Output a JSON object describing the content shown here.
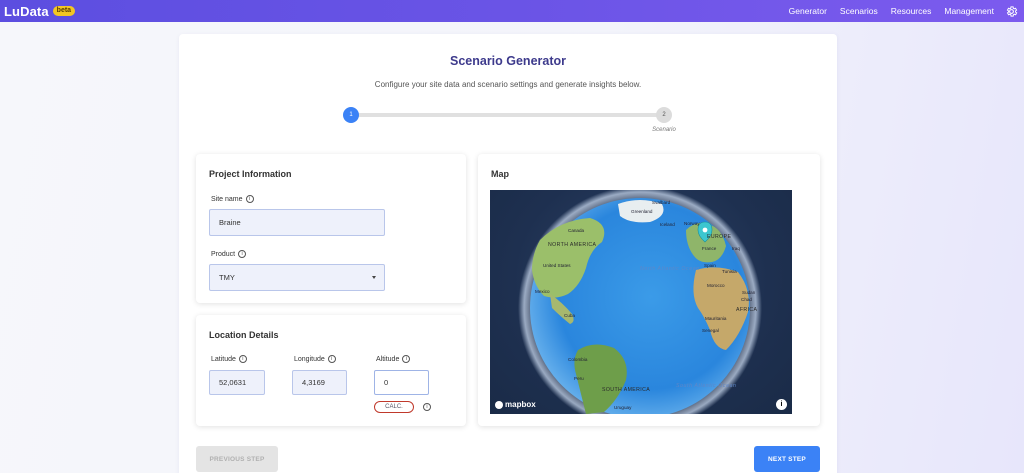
{
  "app": {
    "brand": "LuData",
    "badge": "beta"
  },
  "nav": {
    "items": [
      "Generator",
      "Scenarios",
      "Resources",
      "Management"
    ]
  },
  "page": {
    "title": "Scenario Generator",
    "subtitle": "Configure your site data and scenario settings and generate insights below."
  },
  "stepper": {
    "step1": "1",
    "step2": "2",
    "step2_label": "Scenario"
  },
  "project": {
    "title": "Project Information",
    "site_name_label": "Site name",
    "site_name_value": "Braine",
    "product_label": "Product",
    "product_value": "TMY"
  },
  "location": {
    "title": "Location Details",
    "latitude_label": "Latitude",
    "latitude_value": "52,0631",
    "longitude_label": "Longitude",
    "longitude_value": "4,3169",
    "altitude_label": "Altitude",
    "altitude_value": "0",
    "calc_label": "CALC."
  },
  "map": {
    "title": "Map",
    "attribution": "mapbox",
    "info": "i",
    "places": {
      "svalbard": "Svalbard",
      "greenland": "Greenland",
      "iceland": "Iceland",
      "norway": "Norway",
      "canada": "Canada",
      "north_america": "NORTH AMERICA",
      "europe": "EUROPE",
      "france": "France",
      "iraq": "Iraq",
      "united_states": "United States",
      "spain": "Spain",
      "tunisia": "Tunisia",
      "north_atlantic": "North Atlantic Ocean",
      "mexico": "Mexico",
      "morocco": "Morocco",
      "sudan": "Sudan",
      "chad": "Chad",
      "africa": "AFRICA",
      "cuba": "Cuba",
      "mauritania": "Mauritania",
      "senegal": "Senegal",
      "colombia": "Colombia",
      "peru": "Peru",
      "south_america": "SOUTH AMERICA",
      "uruguay": "Uruguay",
      "south_atlantic": "South Atlantic Ocean"
    }
  },
  "footer": {
    "prev": "PREVIOUS STEP",
    "next": "NEXT STEP"
  }
}
